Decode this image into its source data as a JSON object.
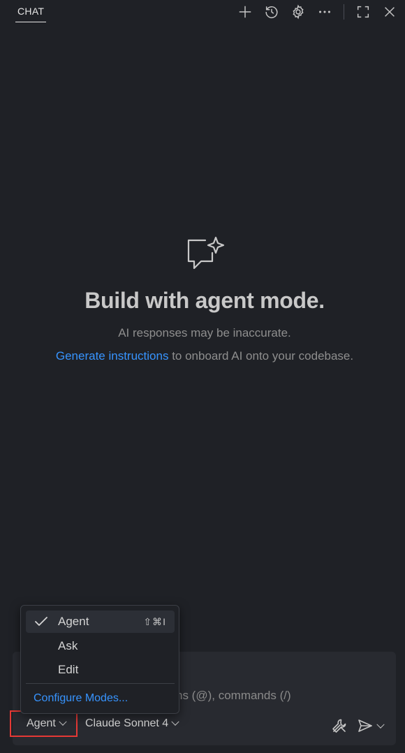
{
  "header": {
    "tab_label": "CHAT",
    "icons": [
      "plus-icon",
      "history-icon",
      "gear-icon",
      "more-icon",
      "maximize-icon",
      "close-icon"
    ]
  },
  "empty_state": {
    "icon": "chat-sparkle-icon",
    "title": "Build with agent mode.",
    "subtitle": "AI responses may be inaccurate.",
    "instructions_link": "Generate instructions",
    "instructions_rest": " to onboard AI onto your codebase."
  },
  "input": {
    "placeholder_visible": "ns (@), commands (/)"
  },
  "toolbar": {
    "mode_label": "Agent",
    "model_label": "Claude Sonnet 4",
    "tools_icon": "tools-icon",
    "send_icon": "send-icon"
  },
  "mode_menu": {
    "items": [
      {
        "label": "Agent",
        "selected": true,
        "shortcut": "⇧⌘I"
      },
      {
        "label": "Ask",
        "selected": false,
        "shortcut": ""
      },
      {
        "label": "Edit",
        "selected": false,
        "shortcut": ""
      }
    ],
    "configure_label": "Configure Modes..."
  },
  "colors": {
    "background": "#1f2126",
    "link": "#3794ff",
    "highlight_border": "#e53935"
  }
}
